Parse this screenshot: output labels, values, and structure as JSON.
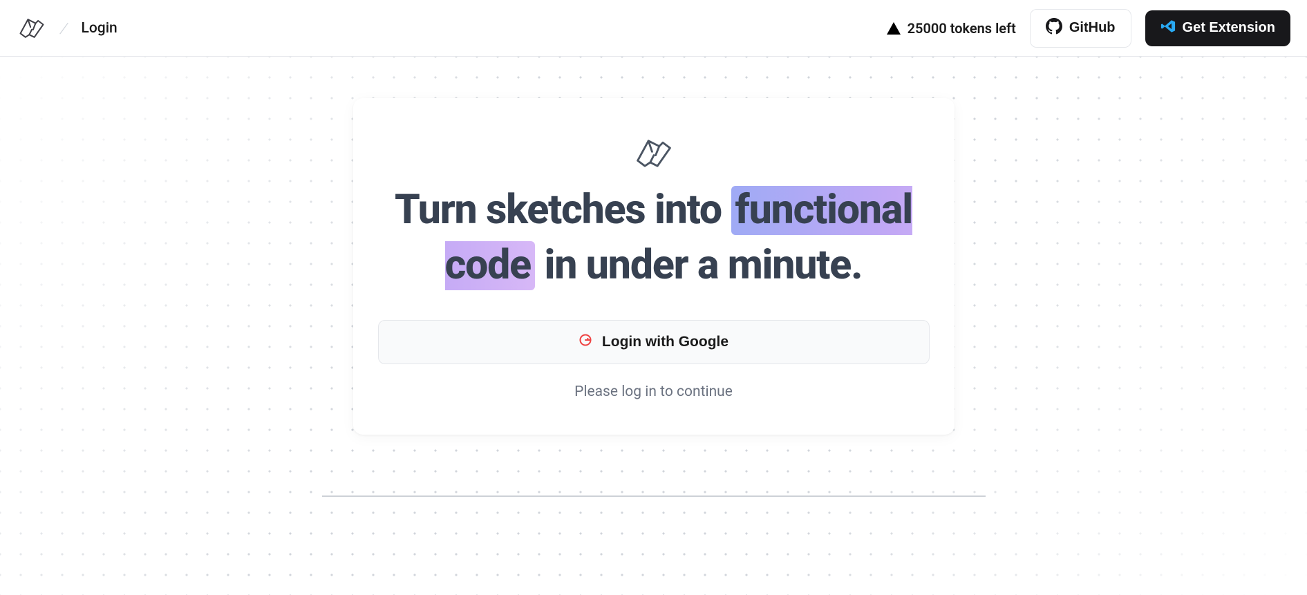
{
  "header": {
    "breadcrumb": "Login",
    "tokens_text": "25000 tokens left",
    "github_label": "GitHub",
    "extension_label": "Get Extension"
  },
  "card": {
    "headline_part1": "Turn sketches into ",
    "headline_highlight": "functional code",
    "headline_part2": " in under a minute.",
    "google_login_label": "Login with Google",
    "continue_text": "Please log in to continue"
  },
  "colors": {
    "accent_gradient_start": "#9faaf5",
    "accent_gradient_end": "#d7b8f7",
    "vscode_blue": "#29a9f2"
  }
}
